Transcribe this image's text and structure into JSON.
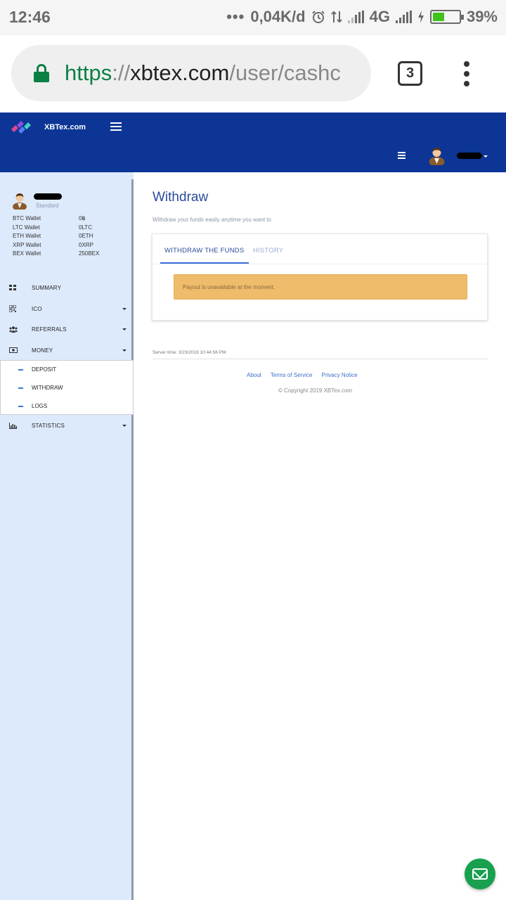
{
  "status_bar": {
    "time": "12:46",
    "dots": "•••",
    "speed": "0,04K/d",
    "network": "4G",
    "battery_percent": "39%",
    "battery_level": 0.39,
    "icons": [
      "alarm-icon",
      "data-transfer-icon",
      "signal-icon",
      "charging-icon",
      "battery-icon"
    ]
  },
  "browser": {
    "url_scheme": "https",
    "url_sep": "://",
    "url_host": "xbtex.com",
    "url_path": "/user/cashc",
    "tab_count": "3",
    "colors": {
      "secure": "#0b8043"
    }
  },
  "header": {
    "brand": "XBTex.com",
    "colors": {
      "background": "#0c3596"
    }
  },
  "sidebar": {
    "user_tier": "Standard",
    "wallets": [
      {
        "label": "BTC Wallet",
        "value": "0฿"
      },
      {
        "label": "LTC Wallet",
        "value": "0LTC"
      },
      {
        "label": "ETH Wallet",
        "value": "0ETH"
      },
      {
        "label": "XRP Wallet",
        "value": "0XRP"
      },
      {
        "label": "BEX Wallet",
        "value": "250BEX"
      }
    ],
    "nav": {
      "summary": "SUMMARY",
      "ico": "ICO",
      "referrals": "REFERRALS",
      "money": "MONEY",
      "statistics": "STATISTICS"
    },
    "money_sub": {
      "deposit": "DEPOSIT",
      "withdraw": "WITHDRAW",
      "logs": "LOGS"
    },
    "colors": {
      "background": "#ddeafb"
    }
  },
  "main": {
    "title": "Withdraw",
    "subtitle": "Withdraw your funds easily anytime you want to",
    "tabs": {
      "active": "WITHDRAW THE FUNDS",
      "history": "HISTORY"
    },
    "alert": "Payout is unavailable at the moment.",
    "server_time": "Server time: 3/23/2019 10:44:56 PM",
    "footer_links": {
      "about": "About",
      "terms": "Terms of Service",
      "privacy": "Privacy Notice"
    },
    "copyright": "© Copyright 2019 XBTex.com",
    "colors": {
      "alert": "#eebc6a",
      "accent": "#3d6dd8"
    }
  },
  "fab": {
    "icon": "mail-icon",
    "color": "#19a04f"
  }
}
